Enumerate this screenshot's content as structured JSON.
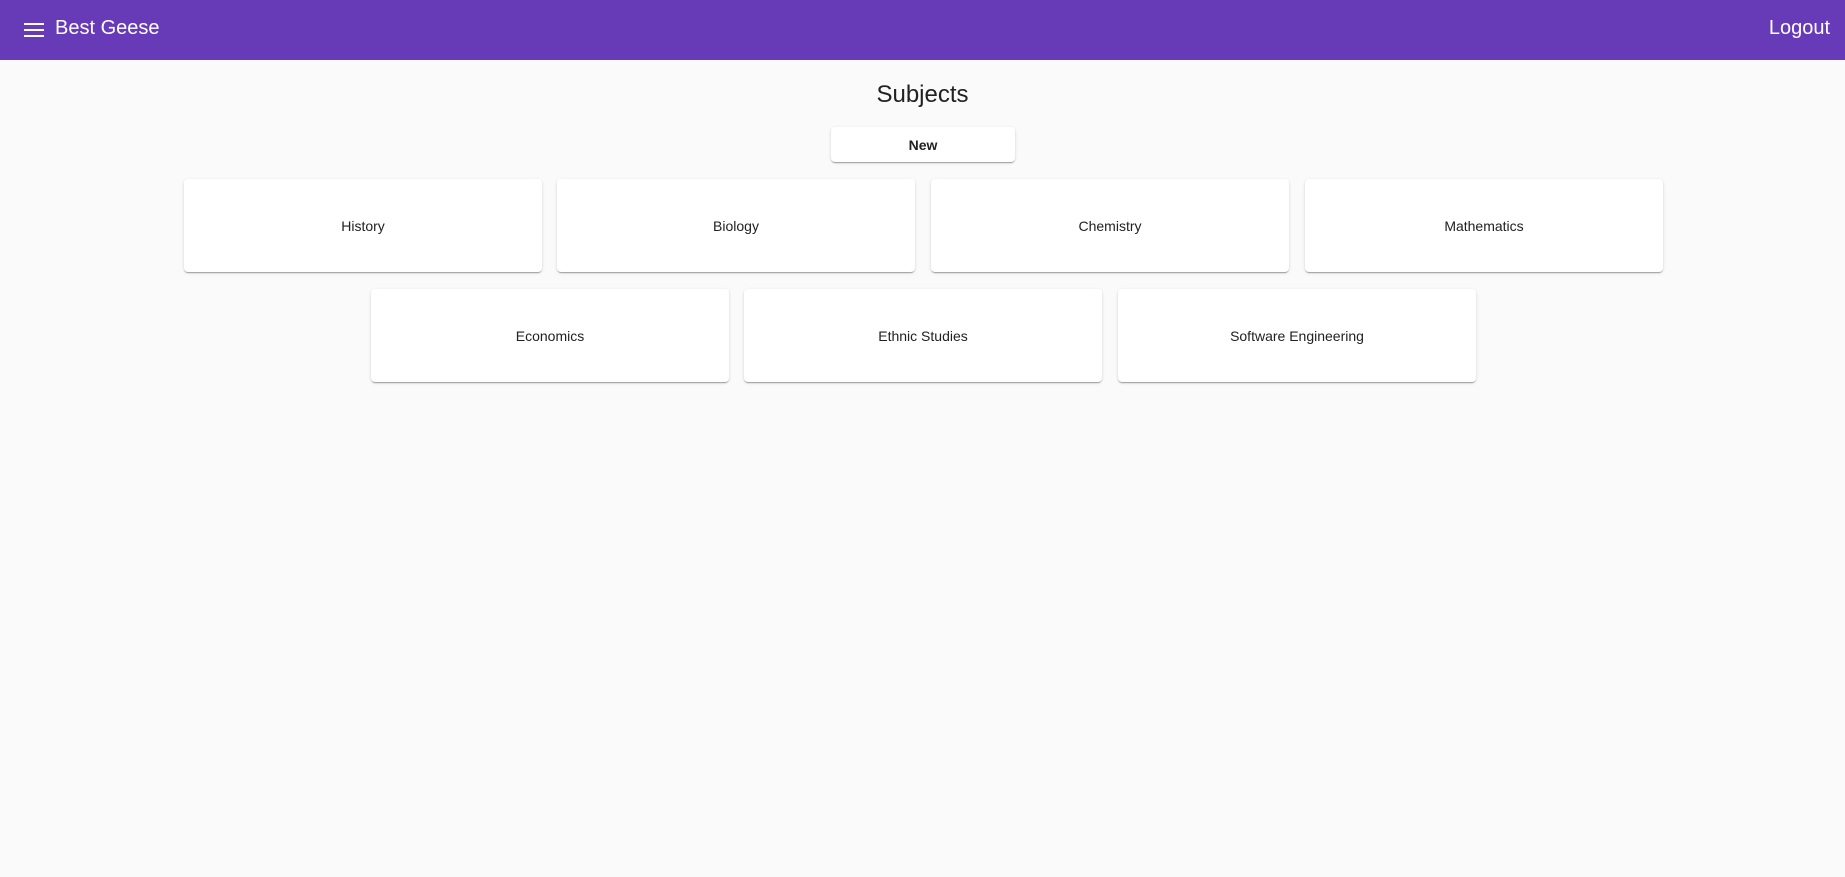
{
  "app": {
    "title": "Best Geese",
    "logout_label": "Logout",
    "accent_color": "#673ab7"
  },
  "main": {
    "page_title": "Subjects",
    "new_button_label": "New",
    "subjects": [
      {
        "label": "History"
      },
      {
        "label": "Biology"
      },
      {
        "label": "Chemistry"
      },
      {
        "label": "Mathematics"
      },
      {
        "label": "Economics"
      },
      {
        "label": "Ethnic Studies"
      },
      {
        "label": "Software Engineering"
      }
    ]
  },
  "icons": {
    "menu": "menu-icon"
  }
}
